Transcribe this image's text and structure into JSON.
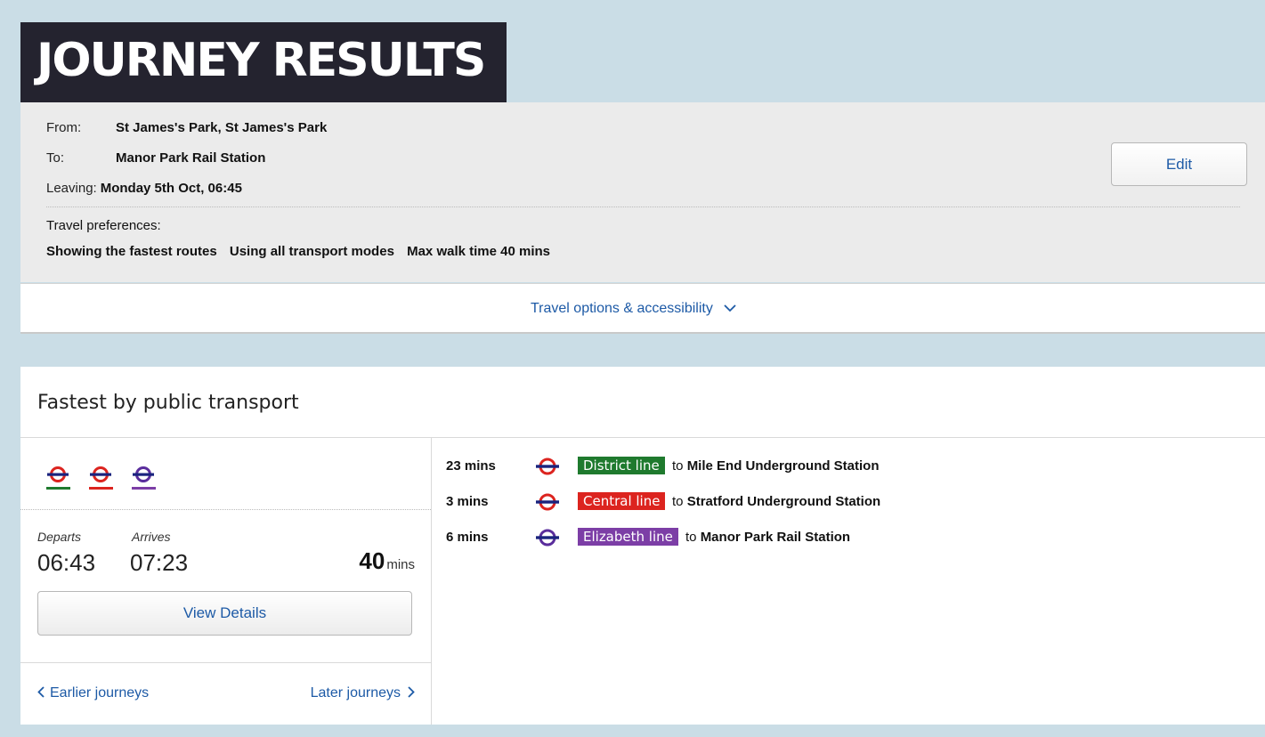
{
  "page": {
    "title": "JOURNEY RESULTS"
  },
  "summary": {
    "from_label": "From:",
    "from_value": "St James's Park, St James's Park",
    "to_label": "To:",
    "to_value": "Manor Park Rail Station",
    "leaving_label": "Leaving:",
    "leaving_value": "Monday 5th Oct, 06:45",
    "preferences_label": "Travel preferences:",
    "preferences": [
      "Showing the fastest routes",
      "Using all transport modes",
      "Max walk time 40 mins"
    ],
    "edit_label": "Edit"
  },
  "options": {
    "label": "Travel options & accessibility",
    "icon": "chevron-down-icon"
  },
  "results": {
    "heading": "Fastest by public transport",
    "modes": [
      {
        "icon": "underground-roundel-icon",
        "color": "#1f7a2e"
      },
      {
        "icon": "underground-roundel-icon",
        "color": "#dc241f"
      },
      {
        "icon": "elizabeth-roundel-icon",
        "color": "#7c3ea6"
      }
    ],
    "departs_label": "Departs",
    "departs_time": "06:43",
    "arrives_label": "Arrives",
    "arrives_time": "07:23",
    "duration_value": "40",
    "duration_unit": "mins",
    "view_details_label": "View Details",
    "earlier_label": "Earlier journeys",
    "later_label": "Later journeys",
    "legs": [
      {
        "duration": "23 mins",
        "line": "District line",
        "line_color": "#1f7a2e",
        "roundel_color": "#dc241f",
        "to_text": "to",
        "destination": "Mile End Underground Station"
      },
      {
        "duration": "3 mins",
        "line": "Central line",
        "line_color": "#dc241f",
        "roundel_color": "#dc241f",
        "to_text": "to",
        "destination": "Stratford Underground Station"
      },
      {
        "duration": "6 mins",
        "line": "Elizabeth line",
        "line_color": "#7c3ea6",
        "roundel_color": "#5a2d9c",
        "to_text": "to",
        "destination": "Manor Park Rail Station"
      }
    ]
  }
}
